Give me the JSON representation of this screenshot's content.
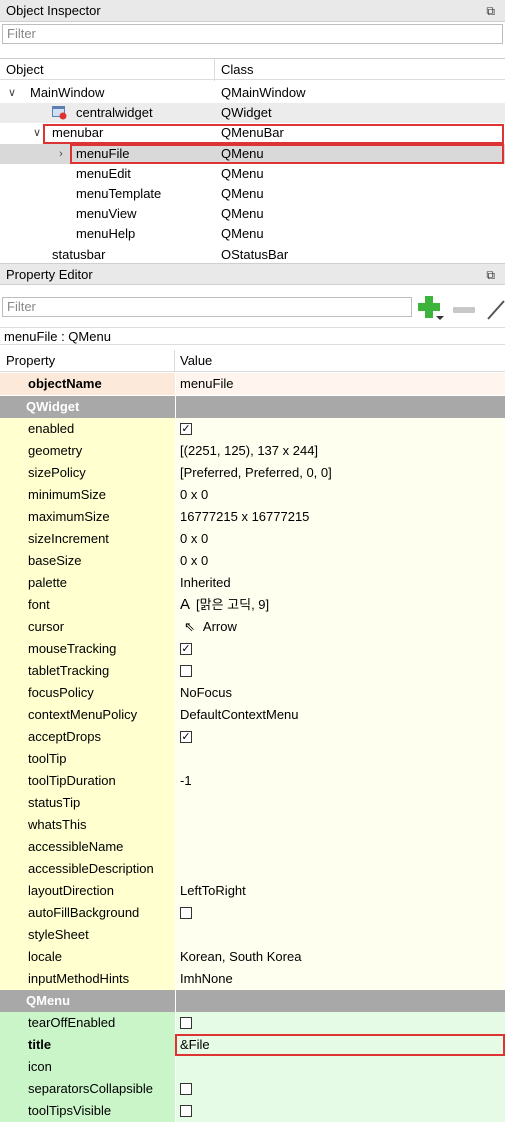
{
  "object_inspector": {
    "title": "Object Inspector",
    "filter_placeholder": "Filter",
    "col_object": "Object",
    "col_class": "Class",
    "rows": [
      {
        "name": "MainWindow",
        "cls": "QMainWindow"
      },
      {
        "name": "centralwidget",
        "cls": "QWidget"
      },
      {
        "name": "menubar",
        "cls": "QMenuBar"
      },
      {
        "name": "menuFile",
        "cls": "QMenu"
      },
      {
        "name": "menuEdit",
        "cls": "QMenu"
      },
      {
        "name": "menuTemplate",
        "cls": "QMenu"
      },
      {
        "name": "menuView",
        "cls": "QMenu"
      },
      {
        "name": "menuHelp",
        "cls": "QMenu"
      },
      {
        "name": "statusbar",
        "cls": "QStatusBar"
      }
    ]
  },
  "property_editor": {
    "title": "Property Editor",
    "filter_placeholder": "Filter",
    "context_label": "menuFile : QMenu",
    "col_property": "Property",
    "col_value": "Value",
    "object_name": {
      "name": "objectName",
      "value": "menuFile"
    },
    "group_qwidget": "QWidget",
    "qwidget": [
      {
        "name": "enabled",
        "value": "",
        "check": "checked",
        "exp": false
      },
      {
        "name": "geometry",
        "value": "[(2251, 125), 137 x 244]",
        "exp": true
      },
      {
        "name": "sizePolicy",
        "value": "[Preferred, Preferred, 0, 0]",
        "exp": true
      },
      {
        "name": "minimumSize",
        "value": "0 x 0",
        "exp": true
      },
      {
        "name": "maximumSize",
        "value": "16777215 x 16777215",
        "exp": true
      },
      {
        "name": "sizeIncrement",
        "value": "0 x 0",
        "exp": true
      },
      {
        "name": "baseSize",
        "value": "0 x 0",
        "exp": true
      },
      {
        "name": "palette",
        "value": "Inherited",
        "exp": false
      },
      {
        "name": "font",
        "value": "[맑은 고딕, 9]",
        "exp": true,
        "icon": "A"
      },
      {
        "name": "cursor",
        "value": "Arrow",
        "exp": false,
        "icon": "cursor"
      },
      {
        "name": "mouseTracking",
        "value": "",
        "check": "checked",
        "exp": false
      },
      {
        "name": "tabletTracking",
        "value": "",
        "check": "unchecked",
        "exp": false
      },
      {
        "name": "focusPolicy",
        "value": "NoFocus",
        "exp": false
      },
      {
        "name": "contextMenuPolicy",
        "value": "DefaultContextMenu",
        "exp": false
      },
      {
        "name": "acceptDrops",
        "value": "",
        "check": "checked",
        "exp": false
      },
      {
        "name": "toolTip",
        "value": "",
        "exp": true
      },
      {
        "name": "toolTipDuration",
        "value": "-1",
        "exp": false
      },
      {
        "name": "statusTip",
        "value": "",
        "exp": true
      },
      {
        "name": "whatsThis",
        "value": "",
        "exp": true
      },
      {
        "name": "accessibleName",
        "value": "",
        "exp": true
      },
      {
        "name": "accessibleDescription",
        "value": "",
        "exp": true
      },
      {
        "name": "layoutDirection",
        "value": "LeftToRight",
        "exp": false
      },
      {
        "name": "autoFillBackground",
        "value": "",
        "check": "unchecked",
        "exp": false
      },
      {
        "name": "styleSheet",
        "value": "",
        "exp": false
      },
      {
        "name": "locale",
        "value": "Korean, South Korea",
        "exp": true
      },
      {
        "name": "inputMethodHints",
        "value": "ImhNone",
        "exp": true
      }
    ],
    "group_qmenu": "QMenu",
    "qmenu": [
      {
        "name": "tearOffEnabled",
        "value": "",
        "check": "unchecked",
        "exp": false
      },
      {
        "name": "title",
        "value": "&File",
        "exp": true,
        "bold": true
      },
      {
        "name": "icon",
        "value": "",
        "exp": true
      },
      {
        "name": "separatorsCollapsible",
        "value": "",
        "check": "unchecked",
        "exp": false
      },
      {
        "name": "toolTipsVisible",
        "value": "",
        "check": "unchecked",
        "exp": false
      }
    ]
  }
}
